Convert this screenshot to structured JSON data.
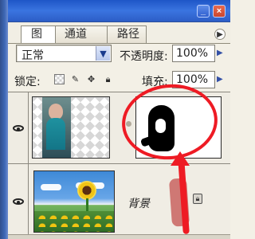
{
  "tabs": [
    {
      "label": "图层"
    },
    {
      "label": "通道"
    },
    {
      "label": "路径"
    }
  ],
  "blend_mode": {
    "value": "正常"
  },
  "opacity": {
    "label": "不透明度:",
    "value": "100%"
  },
  "lock": {
    "label": "锁定:"
  },
  "fill": {
    "label": "填充:",
    "value": "100%"
  },
  "layers": [
    {
      "name": ""
    },
    {
      "name": "背景"
    }
  ],
  "colors": {
    "annotation_red": "#ee1b24",
    "title_blue": "#2c5dc6"
  }
}
